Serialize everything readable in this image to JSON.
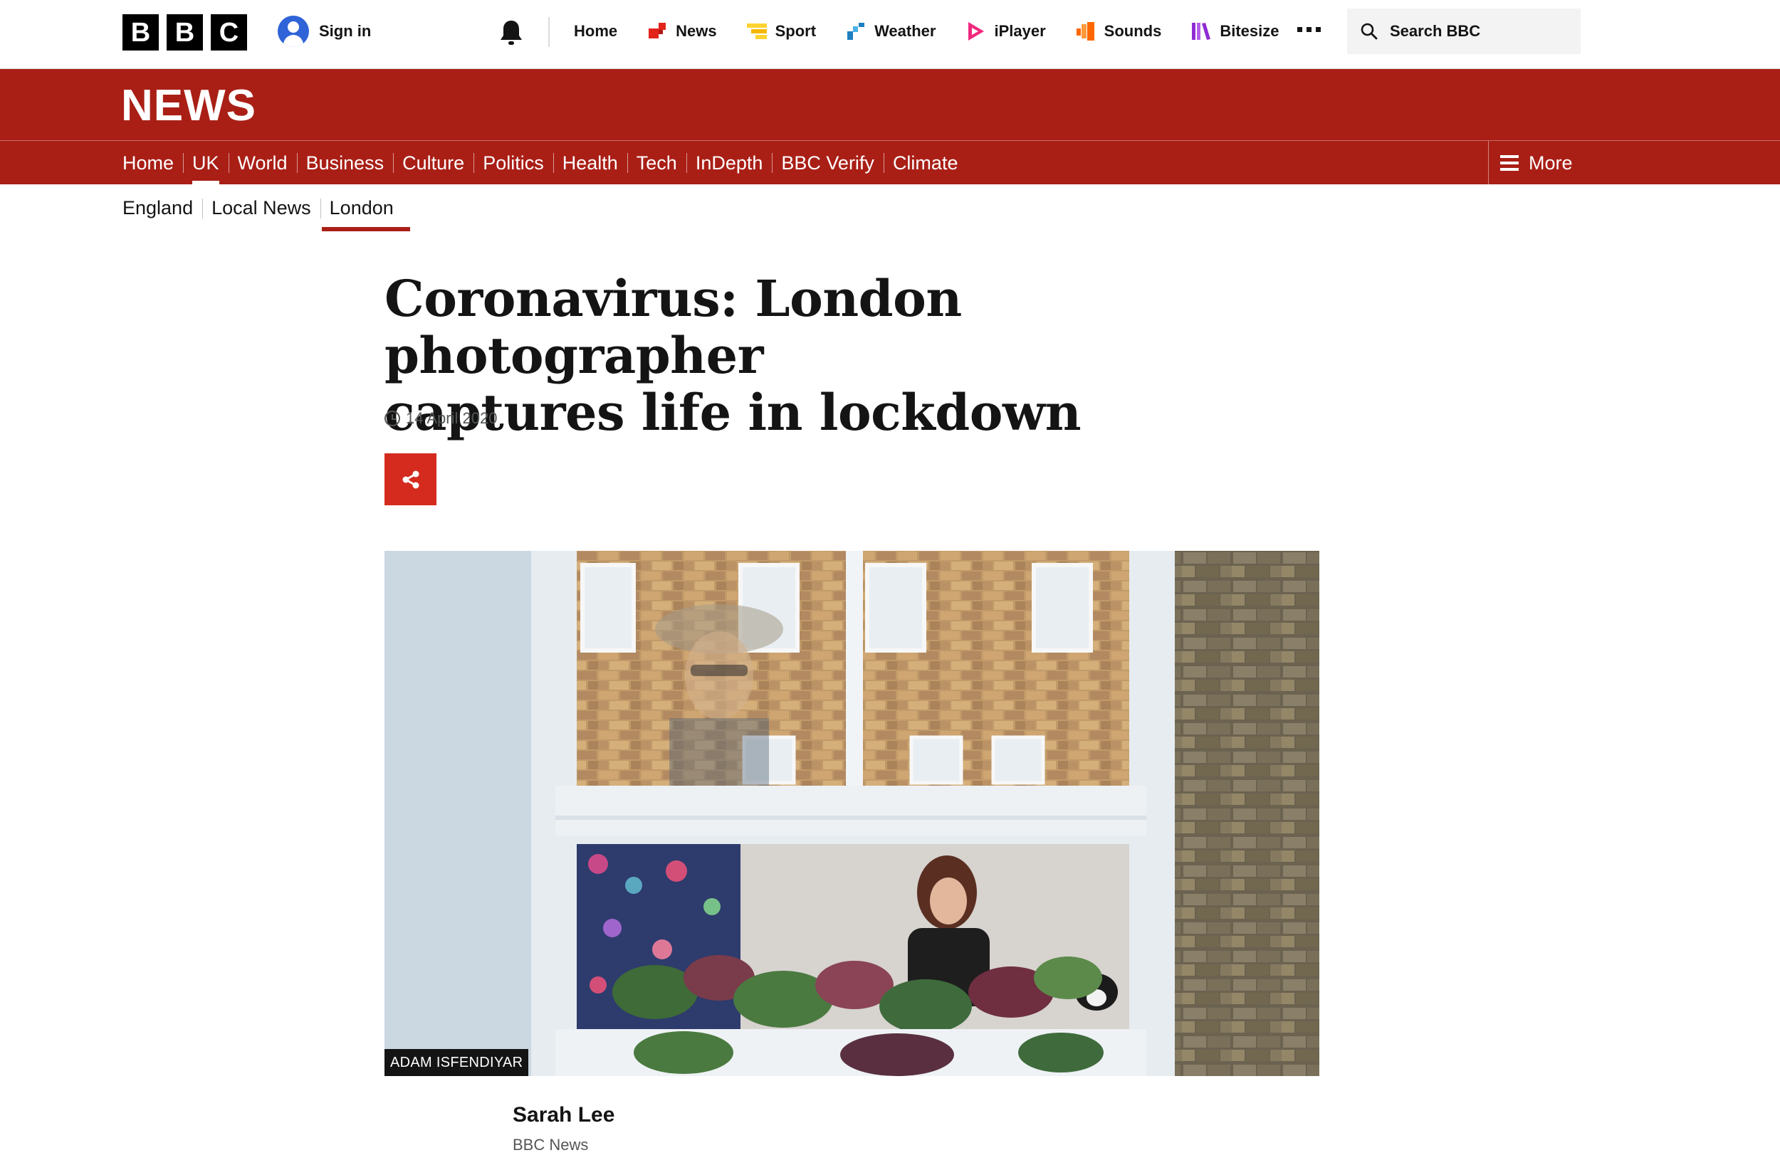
{
  "brand": {
    "letters": [
      "B",
      "B",
      "C"
    ]
  },
  "account": {
    "sign_in_label": "Sign in"
  },
  "global_nav": {
    "items": [
      {
        "label": "Home",
        "icon": "none"
      },
      {
        "label": "News",
        "icon": "news-icon",
        "color": "#e2241a"
      },
      {
        "label": "Sport",
        "icon": "sport-icon",
        "color": "#ffd230"
      },
      {
        "label": "Weather",
        "icon": "weather-icon",
        "color": "#1f7ec0"
      },
      {
        "label": "iPlayer",
        "icon": "iplayer-icon",
        "color": "#f0287e"
      },
      {
        "label": "Sounds",
        "icon": "sounds-icon",
        "color": "#ff6700"
      },
      {
        "label": "Bitesize",
        "icon": "bitesize-icon",
        "color": "#8f2bd3"
      }
    ],
    "search_label": "Search BBC"
  },
  "masthead": {
    "title": "NEWS",
    "color": "#a91f16"
  },
  "news_nav": {
    "items": [
      "Home",
      "UK",
      "World",
      "Business",
      "Culture",
      "Politics",
      "Health",
      "Tech",
      "InDepth",
      "BBC Verify",
      "Climate"
    ],
    "active": "UK",
    "more_label": "More"
  },
  "sub_nav": {
    "items": [
      "England",
      "Local News",
      "London"
    ],
    "active": "London"
  },
  "article": {
    "headline_line1": "Coronavirus: London photographer",
    "headline_line2": "captures life in lockdown",
    "date": "14 April 2020",
    "image_credit": "ADAM ISFENDIYAR",
    "author_name": "Sarah Lee",
    "author_org": "BBC News"
  },
  "colors": {
    "share_button": "#d42b1e",
    "accent_red": "#a91f16"
  }
}
